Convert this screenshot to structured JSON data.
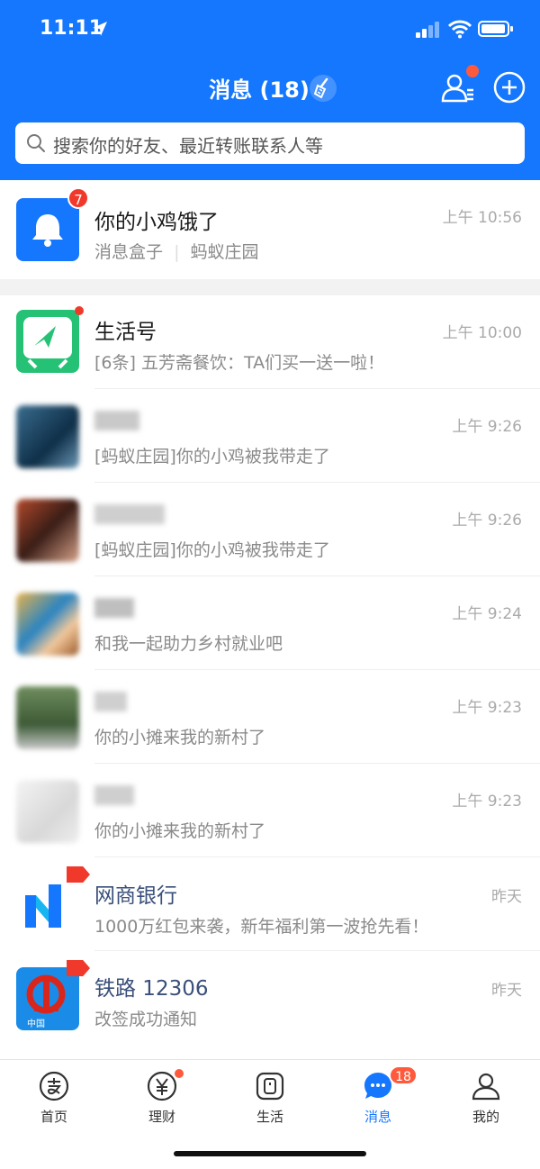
{
  "status": {
    "time": "11:11"
  },
  "header": {
    "title": "消息 (18)"
  },
  "search": {
    "placeholder": "搜索你的好友、最近转账联系人等"
  },
  "messages": [
    {
      "name": "你的小鸡饿了",
      "sub": "消息盒子",
      "sub2": "蚂蚁庄园",
      "time": "上午 10:56",
      "badge": "7"
    },
    {
      "name": "生活号",
      "msg": "[6条] 五芳斋餐饮：TA们买一送一啦！",
      "time": "上午 10:00"
    },
    {
      "name": "",
      "msg": "[蚂蚁庄园]你的小鸡被我带走了",
      "time": "上午 9:26"
    },
    {
      "name": "",
      "msg": "[蚂蚁庄园]你的小鸡被我带走了",
      "time": "上午 9:26"
    },
    {
      "name": "",
      "msg": "和我一起助力乡村就业吧",
      "time": "上午 9:24"
    },
    {
      "name": "",
      "msg": "你的小摊来我的新村了",
      "time": "上午 9:23"
    },
    {
      "name": "",
      "msg": "你的小摊来我的新村了",
      "time": "上午 9:23"
    },
    {
      "name": "网商银行",
      "msg": "1000万红包来袭，新年福利第一波抢先看！",
      "time": "昨天"
    },
    {
      "name": "铁路 12306",
      "msg": "改签成功通知",
      "time": "昨天",
      "logo_text": "中国"
    }
  ],
  "tabs": [
    {
      "label": "首页",
      "icon": "alipay-icon"
    },
    {
      "label": "理财",
      "icon": "yuan-icon"
    },
    {
      "label": "生活",
      "icon": "life-icon"
    },
    {
      "label": "消息",
      "icon": "message-icon",
      "badge": "18"
    },
    {
      "label": "我的",
      "icon": "person-icon"
    }
  ],
  "colors": {
    "brand": "#1577FE",
    "badge": "#F0392B"
  }
}
